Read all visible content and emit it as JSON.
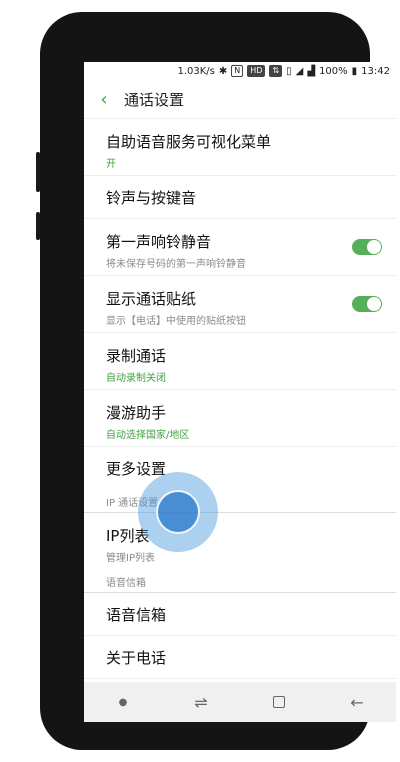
{
  "status_bar": {
    "speed": "1.03K/s",
    "icons": [
      "bluetooth-icon",
      "nfc-icon",
      "hd-icon",
      "data-icon",
      "vibrate-icon",
      "wifi-icon",
      "signal-icon"
    ],
    "hd_label": "HD",
    "nfc_label": "N",
    "battery": "100%",
    "time": "13:42"
  },
  "app_bar": {
    "back_icon": "back-arrow-icon",
    "title": "通话设置"
  },
  "settings": {
    "items": [
      {
        "title": "自助语音服务可视化菜单",
        "subtitle": "开",
        "subtitle_color": "#44a045"
      },
      {
        "title": "铃声与按键音"
      },
      {
        "title": "第一声响铃静音",
        "subtitle": "将未保存号码的第一声响铃静音",
        "toggle": true
      },
      {
        "title": "显示通话贴纸",
        "subtitle": "显示【电话】中使用的贴纸按钮",
        "toggle": true
      },
      {
        "title": "录制通话",
        "subtitle": "自动录制关闭",
        "subtitle_color": "#44a045"
      },
      {
        "title": "漫游助手",
        "subtitle": "自动选择国家/地区",
        "subtitle_color": "#44a045"
      },
      {
        "title": "更多设置"
      }
    ],
    "section_ip": "IP 通话设置",
    "ip_list": {
      "title": "IP列表",
      "subtitle": "管理IP列表"
    },
    "section_voicemail": "语音信箱",
    "voicemail": {
      "title": "语音信箱"
    },
    "about": {
      "title": "关于电话"
    }
  },
  "nav_bar": {
    "icons": [
      "dot-icon",
      "recent-apps-icon",
      "home-icon",
      "back-icon"
    ]
  },
  "colors": {
    "accent": "#44a045",
    "toggle_on": "#56b05a",
    "tap_indicator": "#3c8fd6"
  }
}
